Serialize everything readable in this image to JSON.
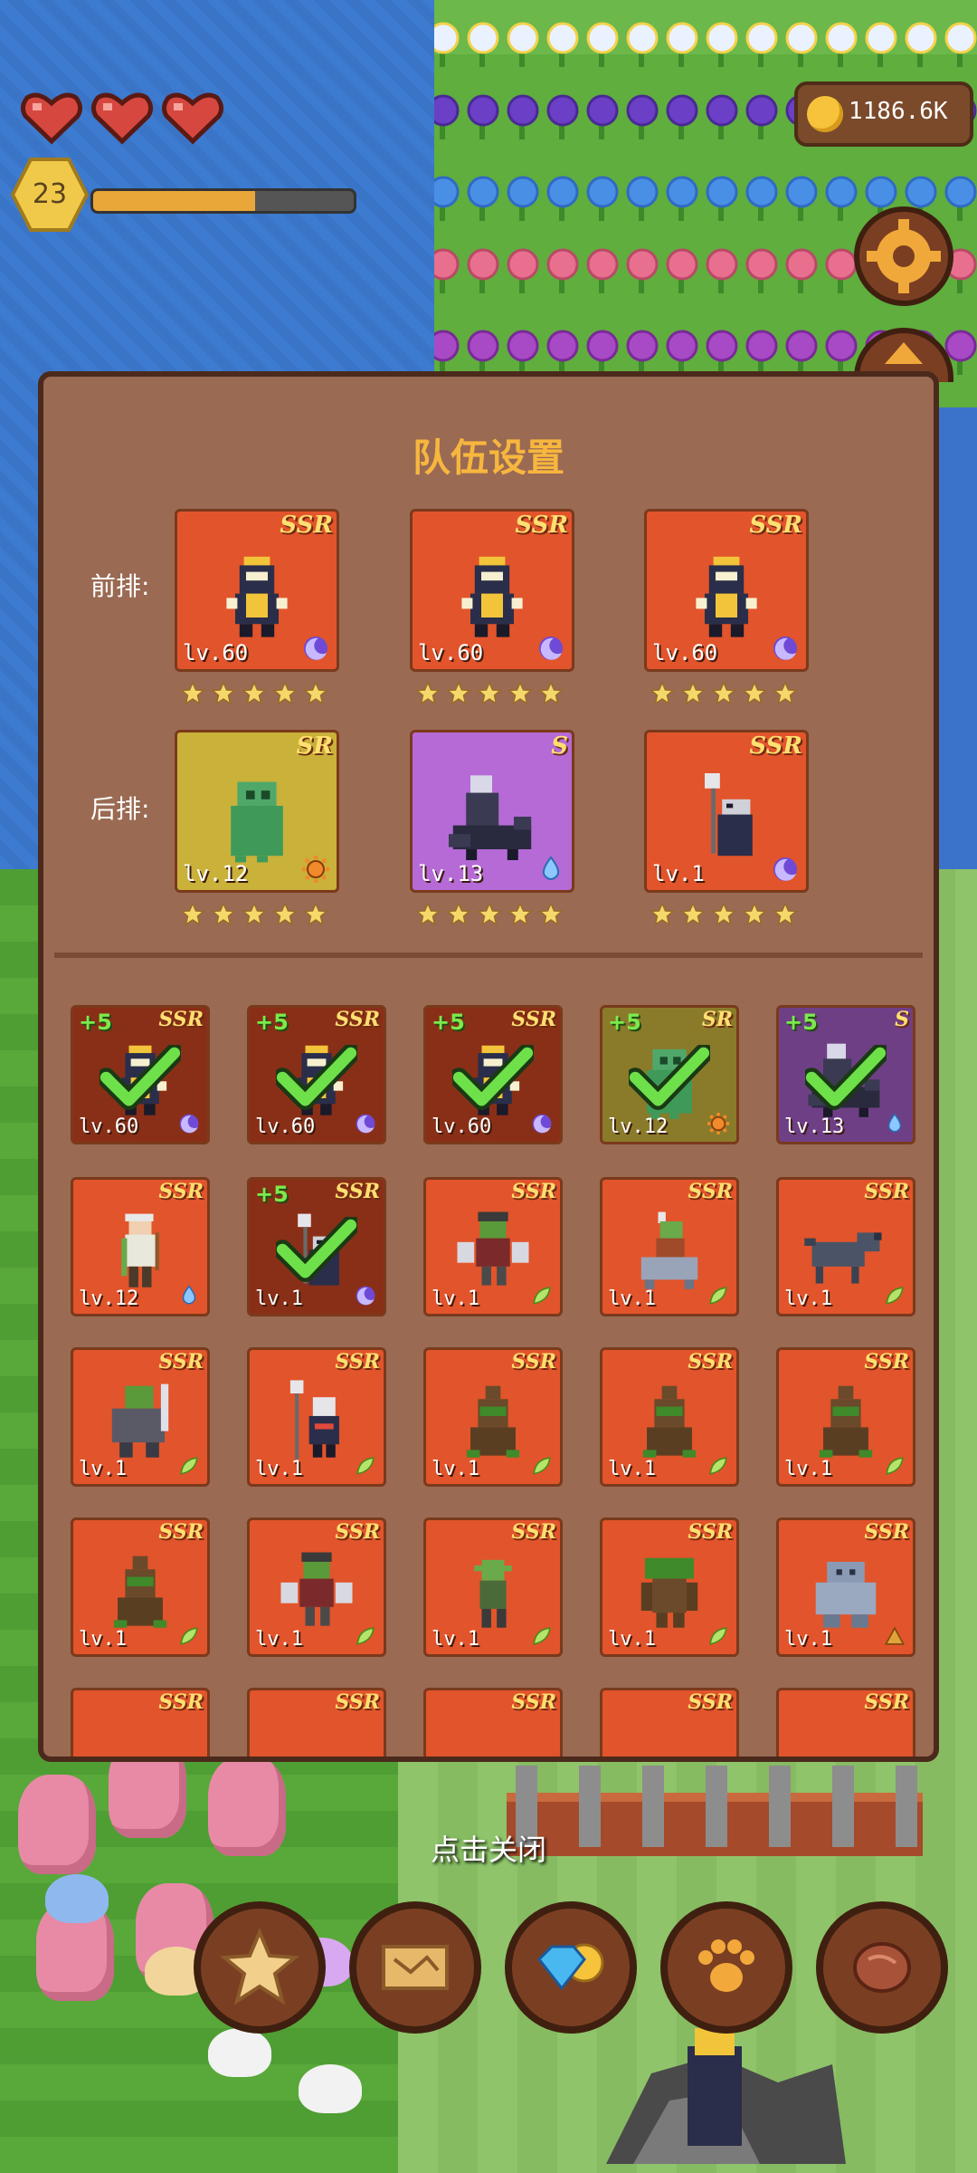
{
  "hud": {
    "hearts": 3,
    "level": "23",
    "xp_fraction": 0.62,
    "coins": "1186.6K"
  },
  "dialog": {
    "title": "队伍设置",
    "front_label": "前排:",
    "back_label": "后排:",
    "front_row": [
      {
        "rarity": "SSR",
        "level": "lv.60",
        "element": "moon-icon",
        "stars": 5,
        "sprite": "armored-knight"
      },
      {
        "rarity": "SSR",
        "level": "lv.60",
        "element": "moon-icon",
        "stars": 5,
        "sprite": "armored-knight"
      },
      {
        "rarity": "SSR",
        "level": "lv.60",
        "element": "moon-icon",
        "stars": 5,
        "sprite": "armored-knight"
      }
    ],
    "back_row": [
      {
        "rarity": "SR",
        "level": "lv.12",
        "element": "sun-icon",
        "stars": 5,
        "sprite": "green-ghost"
      },
      {
        "rarity": "S",
        "level": "lv.13",
        "element": "water-drop-icon",
        "stars": 5,
        "sprite": "hooded-rider"
      },
      {
        "rarity": "SSR",
        "level": "lv.1",
        "element": "moon-icon",
        "stars": 5,
        "sprite": "skull-mage"
      }
    ],
    "roster": [
      {
        "rarity": "SSR",
        "level": "lv.60",
        "plus": "+5",
        "selected": true,
        "element": "moon-icon",
        "sprite": "armored-knight"
      },
      {
        "rarity": "SSR",
        "level": "lv.60",
        "plus": "+5",
        "selected": true,
        "element": "moon-icon",
        "sprite": "armored-knight"
      },
      {
        "rarity": "SSR",
        "level": "lv.60",
        "plus": "+5",
        "selected": true,
        "element": "moon-icon",
        "sprite": "armored-knight"
      },
      {
        "rarity": "SR",
        "level": "lv.12",
        "plus": "+5",
        "selected": true,
        "element": "sun-icon",
        "sprite": "green-ghost"
      },
      {
        "rarity": "S",
        "level": "lv.13",
        "plus": "+5",
        "selected": true,
        "element": "water-drop-icon",
        "sprite": "hooded-rider"
      },
      {
        "rarity": "SSR",
        "level": "lv.12",
        "plus": "",
        "selected": false,
        "element": "water-drop-icon",
        "sprite": "elf-archer"
      },
      {
        "rarity": "SSR",
        "level": "lv.1",
        "plus": "+5",
        "selected": true,
        "element": "moon-icon",
        "sprite": "skull-mage"
      },
      {
        "rarity": "SSR",
        "level": "lv.1",
        "plus": "",
        "selected": false,
        "element": "leaf-icon",
        "sprite": "orc-axeman"
      },
      {
        "rarity": "SSR",
        "level": "lv.1",
        "plus": "",
        "selected": false,
        "element": "leaf-icon",
        "sprite": "goblin-rider"
      },
      {
        "rarity": "SSR",
        "level": "lv.1",
        "plus": "",
        "selected": false,
        "element": "leaf-icon",
        "sprite": "grey-wolf"
      },
      {
        "rarity": "SSR",
        "level": "lv.1",
        "plus": "",
        "selected": false,
        "element": "leaf-icon",
        "sprite": "orc-warrior"
      },
      {
        "rarity": "SSR",
        "level": "lv.1",
        "plus": "",
        "selected": false,
        "element": "leaf-icon",
        "sprite": "skeleton-shaman"
      },
      {
        "rarity": "SSR",
        "level": "lv.1",
        "plus": "",
        "selected": false,
        "element": "leaf-icon",
        "sprite": "treant"
      },
      {
        "rarity": "SSR",
        "level": "lv.1",
        "plus": "",
        "selected": false,
        "element": "leaf-icon",
        "sprite": "treant"
      },
      {
        "rarity": "SSR",
        "level": "lv.1",
        "plus": "",
        "selected": false,
        "element": "leaf-icon",
        "sprite": "treant"
      },
      {
        "rarity": "SSR",
        "level": "lv.1",
        "plus": "",
        "selected": false,
        "element": "leaf-icon",
        "sprite": "treant"
      },
      {
        "rarity": "SSR",
        "level": "lv.1",
        "plus": "",
        "selected": false,
        "element": "leaf-icon",
        "sprite": "orc-axeman"
      },
      {
        "rarity": "SSR",
        "level": "lv.1",
        "plus": "",
        "selected": false,
        "element": "leaf-icon",
        "sprite": "goblin"
      },
      {
        "rarity": "SSR",
        "level": "lv.1",
        "plus": "",
        "selected": false,
        "element": "leaf-icon",
        "sprite": "tree-giant"
      },
      {
        "rarity": "SSR",
        "level": "lv.1",
        "plus": "",
        "selected": false,
        "element": "earth-icon",
        "sprite": "stone-golem"
      },
      {
        "rarity": "SSR",
        "level": "",
        "plus": "",
        "selected": false,
        "element": "",
        "sprite": "partial"
      },
      {
        "rarity": "SSR",
        "level": "",
        "plus": "",
        "selected": false,
        "element": "",
        "sprite": "partial"
      },
      {
        "rarity": "SSR",
        "level": "",
        "plus": "",
        "selected": false,
        "element": "",
        "sprite": "partial"
      },
      {
        "rarity": "SSR",
        "level": "",
        "plus": "",
        "selected": false,
        "element": "",
        "sprite": "partial"
      },
      {
        "rarity": "SSR",
        "level": "",
        "plus": "",
        "selected": false,
        "element": "",
        "sprite": "partial"
      }
    ]
  },
  "close_hint": "点击关闭",
  "bottom_nav": [
    {
      "name": "favorites-button",
      "icon": "star-icon"
    },
    {
      "name": "map-button",
      "icon": "scroll-map-icon"
    },
    {
      "name": "shop-button",
      "icon": "diamond-coin-icon"
    },
    {
      "name": "pets-button",
      "icon": "paw-icon"
    },
    {
      "name": "food-button",
      "icon": "meat-icon"
    }
  ],
  "colors": {
    "ssr_card": "#e2542b",
    "ssr_card_selected": "#8a2f17",
    "sr_card": "#c9b13a",
    "sr_card_selected": "#8a7b2a",
    "s_card": "#b56ad6",
    "s_card_selected": "#6f3f86",
    "title": "#f7b63e",
    "dialog_bg": "#9a6a53"
  }
}
